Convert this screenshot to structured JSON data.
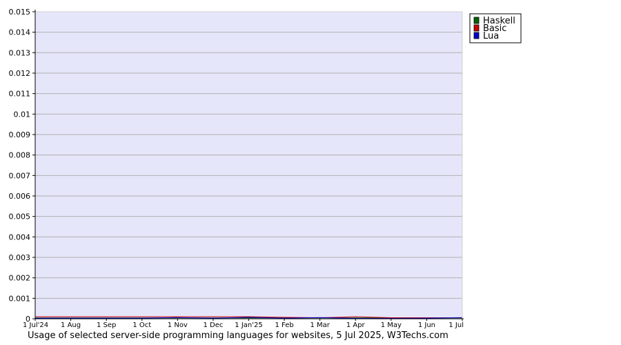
{
  "chart_data": {
    "type": "line",
    "title": "",
    "caption": "Usage of selected server-side programming languages for websites, 5 Jul 2025, W3Techs.com",
    "xlabel": "",
    "ylabel": "",
    "x_tick_labels": [
      "1 Jul'24",
      "1 Aug",
      "1 Sep",
      "1 Oct",
      "1 Nov",
      "1 Dec",
      "1 Jan'25",
      "1 Feb",
      "1 Mar",
      "1 Apr",
      "1 May",
      "1 Jun",
      "1 Jul"
    ],
    "y_tick_labels": [
      "0",
      "0.001",
      "0.002",
      "0.003",
      "0.004",
      "0.005",
      "0.006",
      "0.007",
      "0.008",
      "0.009",
      "0.01",
      "0.011",
      "0.012",
      "0.013",
      "0.014",
      "0.015"
    ],
    "ylim": [
      0,
      0.015
    ],
    "grid": true,
    "legend_position": "top-right-outside",
    "plot_background": "#e6e6fa",
    "grid_color": "#b0b0b0",
    "series": [
      {
        "name": "Haskell",
        "color": "#006400",
        "values": [
          4e-05,
          4e-05,
          4e-05,
          4e-05,
          4e-05,
          4e-05,
          4e-05,
          4e-05,
          4e-05,
          4e-05,
          4e-05,
          4e-05,
          4e-05
        ]
      },
      {
        "name": "Basic",
        "color": "#cc0000",
        "values": [
          0.0001,
          0.0001,
          0.0001,
          0.0001,
          0.0001,
          0.0001,
          0.0001,
          7e-05,
          5e-05,
          0.0001,
          5e-05,
          5e-05,
          5e-05
        ]
      },
      {
        "name": "Lua",
        "color": "#0000cc",
        "values": [
          3e-05,
          3e-05,
          3e-05,
          3e-05,
          6e-05,
          3e-05,
          7e-05,
          3e-05,
          6e-05,
          2e-05,
          2e-05,
          3e-05,
          6e-05
        ]
      }
    ]
  }
}
